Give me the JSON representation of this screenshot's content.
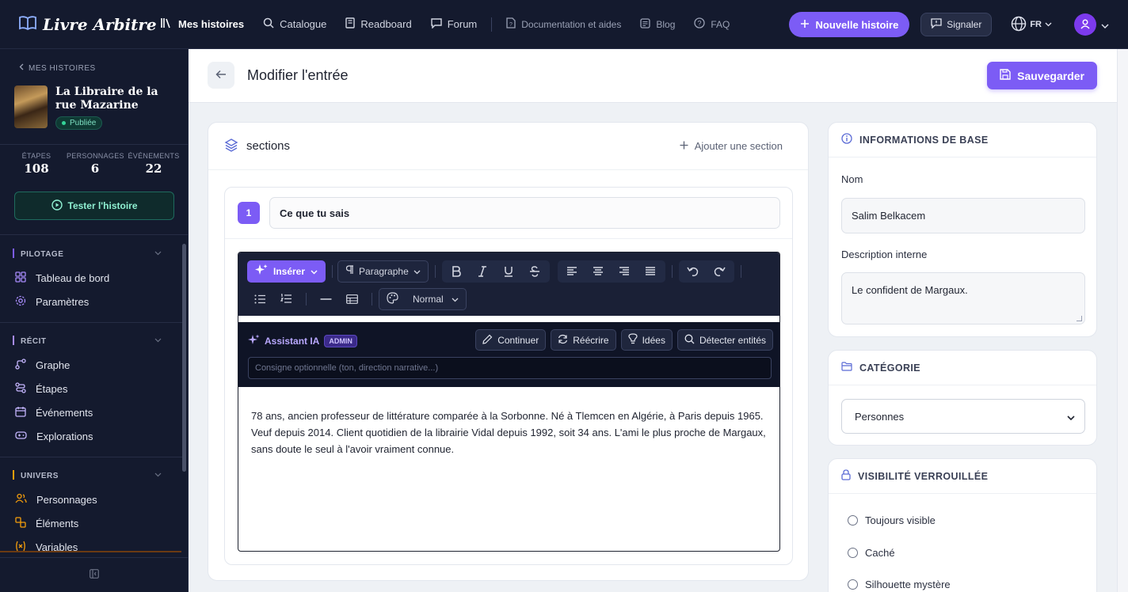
{
  "brand": {
    "name": "Livre Arbitre"
  },
  "nav": {
    "items": [
      {
        "label": "Mes histoires",
        "icon": "library-icon",
        "active": true
      },
      {
        "label": "Catalogue",
        "icon": "search-icon"
      },
      {
        "label": "Readboard",
        "icon": "book-icon"
      },
      {
        "label": "Forum",
        "icon": "chat-icon"
      }
    ],
    "secondary": [
      {
        "label": "Documentation et aides",
        "icon": "doc-icon"
      },
      {
        "label": "Blog",
        "icon": "blog-icon"
      },
      {
        "label": "FAQ",
        "icon": "help-icon"
      }
    ],
    "new_story": "Nouvelle histoire",
    "report": "Signaler",
    "lang": "FR"
  },
  "sidebar": {
    "back": "MES HISTOIRES",
    "story_title": "La Libraire de la rue Mazarine",
    "status": "Publiée",
    "stats": [
      {
        "label": "ÉTAPES",
        "value": "108"
      },
      {
        "label": "PERSONNAGES",
        "value": "6"
      },
      {
        "label": "ÉVÉNEMENTS",
        "value": "22"
      }
    ],
    "test_button": "Tester l'histoire",
    "sections": [
      {
        "title": "PILOTAGE",
        "color": "#7c5cf5",
        "items": [
          {
            "label": "Tableau de bord",
            "icon": "dashboard-icon"
          },
          {
            "label": "Paramètres",
            "icon": "gear-icon"
          }
        ]
      },
      {
        "title": "RÉCIT",
        "color": "#a78bfa",
        "items": [
          {
            "label": "Graphe",
            "icon": "graph-icon"
          },
          {
            "label": "Étapes",
            "icon": "steps-icon"
          },
          {
            "label": "Événements",
            "icon": "calendar-icon"
          },
          {
            "label": "Explorations",
            "icon": "gamepad-icon"
          }
        ]
      },
      {
        "title": "UNIVERS",
        "color": "#f59e0b",
        "items": [
          {
            "label": "Personnages",
            "icon": "users-icon"
          },
          {
            "label": "Éléments",
            "icon": "shapes-icon"
          },
          {
            "label": "Variables",
            "icon": "variable-icon"
          }
        ]
      }
    ]
  },
  "header": {
    "title": "Modifier l'entrée",
    "save": "Sauvegarder"
  },
  "sections_card": {
    "title": "sections",
    "add": "Ajouter une section",
    "section": {
      "number": "1",
      "name": "Ce que tu sais",
      "toolbar": {
        "insert": "Insérer",
        "paragraph": "Paragraphe",
        "style": "Normal"
      },
      "ai": {
        "title": "Assistant IA",
        "badge": "ADMIN",
        "buttons": [
          "Continuer",
          "Réécrire",
          "Idées",
          "Détecter entités"
        ],
        "placeholder": "Consigne optionnelle (ton, direction narrative...)"
      },
      "text": "78 ans, ancien professeur de littérature comparée à la Sorbonne. Né à Tlemcen en Algérie, à Paris depuis 1965. Veuf depuis 2014. Client quotidien de la librairie Vidal depuis 1992, soit 34 ans. L'ami le plus proche de Margaux, sans doute le seul à l'avoir vraiment connue."
    }
  },
  "info_card": {
    "title": "INFORMATIONS DE BASE",
    "name_label": "Nom",
    "name_value": "Salim Belkacem",
    "desc_label": "Description interne",
    "desc_value": "Le confident de Margaux."
  },
  "category_card": {
    "title": "CATÉGORIE",
    "selected": "Personnes"
  },
  "visibility_card": {
    "title": "VISIBILITÉ VERROUILLÉE",
    "options": [
      "Toujours visible",
      "Caché",
      "Silhouette mystère"
    ]
  }
}
